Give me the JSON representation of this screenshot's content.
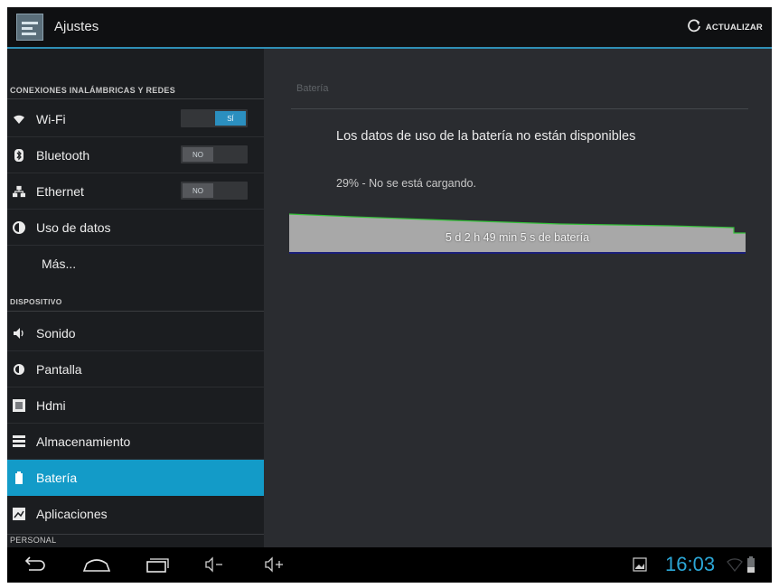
{
  "app": {
    "title": "Ajustes",
    "refresh_label": "ACTUALIZAR"
  },
  "sidebar": {
    "sections": [
      {
        "label": "CONEXIONES INALÁMBRICAS Y REDES"
      },
      {
        "label": "DISPOSITIVO"
      },
      {
        "label": "PERSONAL"
      }
    ],
    "items": [
      {
        "label": "Wi-Fi",
        "icon": "wifi-icon",
        "toggle": "SÍ"
      },
      {
        "label": "Bluetooth",
        "icon": "bluetooth-icon",
        "toggle": "NO"
      },
      {
        "label": "Ethernet",
        "icon": "ethernet-icon",
        "toggle": "NO"
      },
      {
        "label": "Uso de datos",
        "icon": "data-usage-icon"
      },
      {
        "label": "Más..."
      },
      {
        "label": "Sonido",
        "icon": "speaker-icon"
      },
      {
        "label": "Pantalla",
        "icon": "brightness-icon"
      },
      {
        "label": "Hdmi",
        "icon": "hdmi-icon"
      },
      {
        "label": "Almacenamiento",
        "icon": "storage-icon"
      },
      {
        "label": "Batería",
        "icon": "battery-icon",
        "selected": true
      },
      {
        "label": "Aplicaciones",
        "icon": "apps-icon"
      }
    ]
  },
  "content": {
    "breadcrumb": "Batería",
    "message": "Los datos de uso de la batería no están disponibles",
    "status": "29% - No se está cargando.",
    "graph_label": "5 d 2 h 49 min 5 s de batería"
  },
  "statusbar": {
    "time": "16:03"
  },
  "colors": {
    "accent": "#139bc8",
    "clock": "#2ba6d6",
    "graph_fill": "#a8a8a8",
    "graph_line": "#35c23a"
  }
}
